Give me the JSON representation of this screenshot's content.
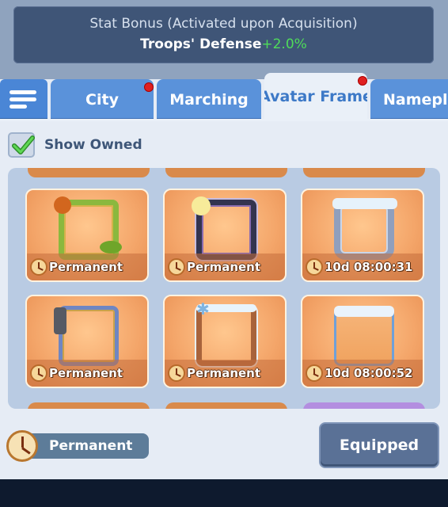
{
  "stat_panel": {
    "title": "Stat Bonus (Activated upon Acquisition)",
    "stat_name": "Troops' Defense",
    "stat_value": "+2.0%"
  },
  "tabs": [
    {
      "label": "City",
      "has_dot": true,
      "active": false
    },
    {
      "label": "Marching",
      "has_dot": false,
      "active": false
    },
    {
      "label": "Avatar Frame",
      "has_dot": true,
      "active": true
    },
    {
      "label": "Namepla",
      "has_dot": false,
      "active": false
    }
  ],
  "filter": {
    "label": "Show Owned",
    "checked": true
  },
  "items": [
    {
      "duration": "Permanent",
      "frame": "harvest-vine-frame"
    },
    {
      "duration": "Permanent",
      "frame": "moonlight-night-frame"
    },
    {
      "duration": "10d 08:00:31",
      "frame": "ice-frame"
    },
    {
      "duration": "Permanent",
      "frame": "steampunk-frame"
    },
    {
      "duration": "Permanent",
      "frame": "snowflake-frame"
    },
    {
      "duration": "10d 08:00:52",
      "frame": "winter-scene-frame"
    }
  ],
  "selected": {
    "duration": "Permanent"
  },
  "equip_button": {
    "label": "Equipped"
  },
  "colors": {
    "accent": "#4a86d6",
    "bonus": "#4fdc5a",
    "card": "#f4a66a"
  }
}
